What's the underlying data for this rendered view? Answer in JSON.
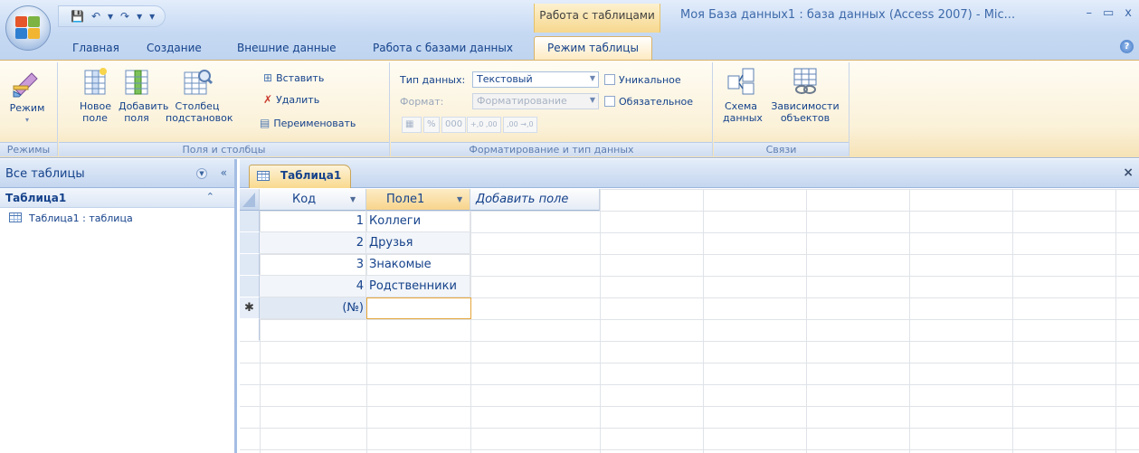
{
  "window": {
    "title": "Моя База данных1 : база данных (Access 2007) - Mic...",
    "context_label": "Работа с таблицами",
    "controls": [
      "–",
      "▭",
      "x"
    ]
  },
  "quick_access": [
    "💾",
    "↶",
    "▾",
    "↷",
    "▾",
    "▾"
  ],
  "tabs": [
    {
      "label": "Главная"
    },
    {
      "label": "Создание"
    },
    {
      "label": "Внешние данные"
    },
    {
      "label": "Работа с базами данных"
    },
    {
      "label": "Режим таблицы",
      "active": true
    }
  ],
  "ribbon": {
    "groups": {
      "views": {
        "label": "Режимы",
        "mode_button": "Режим"
      },
      "fields": {
        "label": "Поля и столбцы",
        "new_field": "Новое поле",
        "add_fields": "Добавить поля",
        "lookup_column": "Столбец подстановок",
        "insert": "Вставить",
        "delete": "Удалить",
        "rename": "Переименовать"
      },
      "format": {
        "label": "Форматирование и тип данных",
        "data_type_label": "Тип данных:",
        "data_type_value": "Текстовый",
        "format_label": "Формат:",
        "format_value": "Форматирование",
        "unique_label": "Уникальное",
        "required_label": "Обязательное",
        "fmt_buttons": [
          "%",
          "000",
          "+,0 ,00",
          ",00 →,0"
        ]
      },
      "relations": {
        "label": "Связи",
        "relationships": "Схема данных",
        "dependencies": "Зависимости объектов"
      }
    }
  },
  "nav_pane": {
    "title": "Все таблицы",
    "group": "Таблица1",
    "items": [
      {
        "label": "Таблица1 : таблица"
      }
    ]
  },
  "document": {
    "tab_label": "Таблица1",
    "columns": [
      "Код",
      "Поле1",
      "Добавить поле"
    ],
    "rows": [
      {
        "id": "1",
        "field1": "Коллеги"
      },
      {
        "id": "2",
        "field1": "Друзья"
      },
      {
        "id": "3",
        "field1": "Знакомые"
      },
      {
        "id": "4",
        "field1": "Родственники"
      }
    ],
    "new_row_id": "(№)",
    "new_row_marker": "✱"
  }
}
